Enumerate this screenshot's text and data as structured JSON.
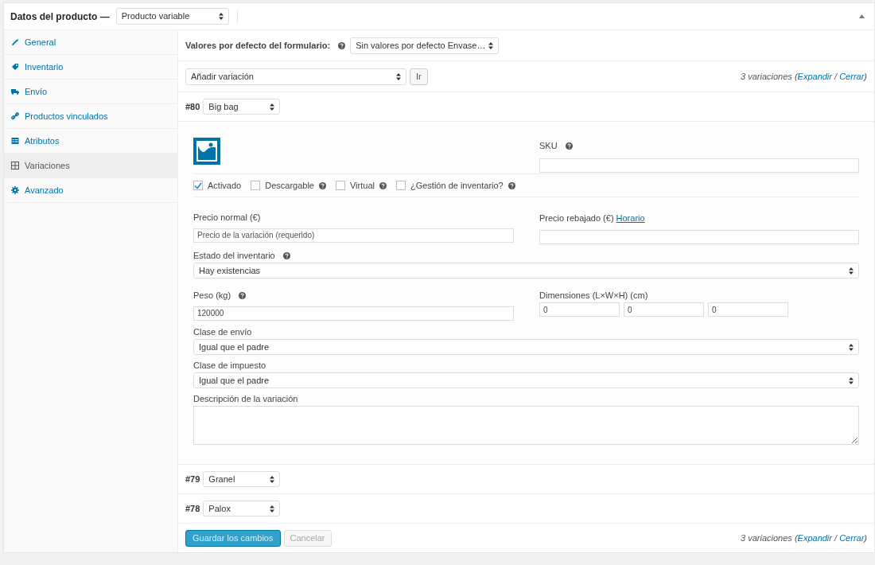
{
  "header": {
    "title": "Datos del producto —",
    "product_type": "Producto variable"
  },
  "sidebar": {
    "items": [
      {
        "label": "General",
        "selected": false
      },
      {
        "label": "Inventario",
        "selected": false
      },
      {
        "label": "Envío",
        "selected": false
      },
      {
        "label": "Productos vinculados",
        "selected": false
      },
      {
        "label": "Atributos",
        "selected": false
      },
      {
        "label": "Variaciones",
        "selected": true
      },
      {
        "label": "Avanzado",
        "selected": false
      }
    ]
  },
  "defaults": {
    "label": "Valores por defecto del formulario:",
    "value": "Sin valores por defecto Envase…"
  },
  "toolbar": {
    "action": "Añadir variación",
    "go_button": "Ir",
    "summary": {
      "prefix": "3 variaciones (",
      "expand": "Expandir",
      "separator": " / ",
      "collapse": "Cerrar",
      "suffix": ")"
    }
  },
  "variations": [
    {
      "number": "#80",
      "value": "Big bag",
      "expanded": true
    },
    {
      "number": "#79",
      "value": "Granel",
      "expanded": false
    },
    {
      "number": "#78",
      "value": "Palox",
      "expanded": false
    }
  ],
  "details": {
    "sku_label": "SKU",
    "options": [
      {
        "label": "Activado",
        "checked": true,
        "help": false
      },
      {
        "label": "Descargable",
        "checked": false,
        "help": true
      },
      {
        "label": "Virtual",
        "checked": false,
        "help": true
      },
      {
        "label": "¿Gestión de inventario?",
        "checked": false,
        "help": true
      }
    ],
    "regular_price": {
      "label": "Precio normal (€)",
      "placeholder": "Precio de la variación (requerido)"
    },
    "sale_price": {
      "label": "Precio rebajado (€)",
      "link": "Horario"
    },
    "stock_status": {
      "label": "Estado del inventario",
      "value": "Hay existencias"
    },
    "weight": {
      "label": "Peso (kg)",
      "value": "120000"
    },
    "dimensions": {
      "label": "Dimensiones (L×W×H) (cm)",
      "values": [
        "0",
        "0",
        "0"
      ]
    },
    "shipping_class": {
      "label": "Clase de envío",
      "value": "Igual que el padre"
    },
    "tax_class": {
      "label": "Clase de impuesto",
      "value": "Igual que el padre"
    },
    "description": {
      "label": "Descripción de la variación"
    }
  },
  "footer": {
    "save": "Guardar los cambios",
    "cancel": "Cancelar",
    "summary": {
      "prefix": "3 variaciones (",
      "expand": "Expandir",
      "separator": " / ",
      "collapse": "Cerrar",
      "suffix": ")"
    }
  }
}
